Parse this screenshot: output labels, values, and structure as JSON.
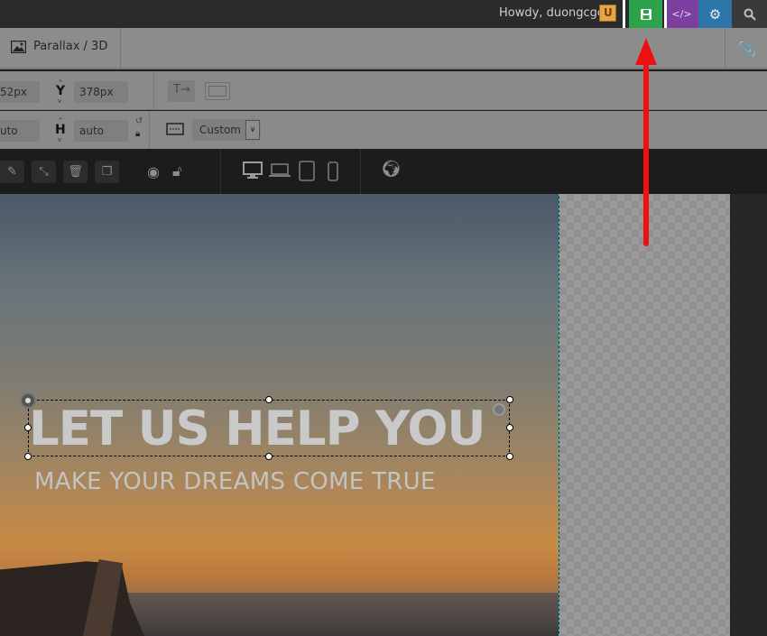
{
  "adminbar": {
    "greeting": "Howdy, duongcgc",
    "code_label": "</>",
    "save_icon": "save-icon",
    "gear_icon": "gear-icon",
    "search_icon": "search-icon"
  },
  "tabs": {
    "parallax_label": "Parallax / 3D"
  },
  "position": {
    "x_value": "52px",
    "y_label": "Y",
    "y_value": "378px"
  },
  "size": {
    "w_value": "uto",
    "h_label": "H",
    "h_value": "auto",
    "preset": "Custom"
  },
  "layer": {
    "headline": "LET US HELP YOU",
    "subline": "MAKE YOUR DREAMS COME TRUE"
  },
  "colors": {
    "save_button": "#2ca34b",
    "code_button": "#7b3fa0",
    "gear_button": "#2d74a8",
    "annotation_arrow": "#ee1111"
  }
}
